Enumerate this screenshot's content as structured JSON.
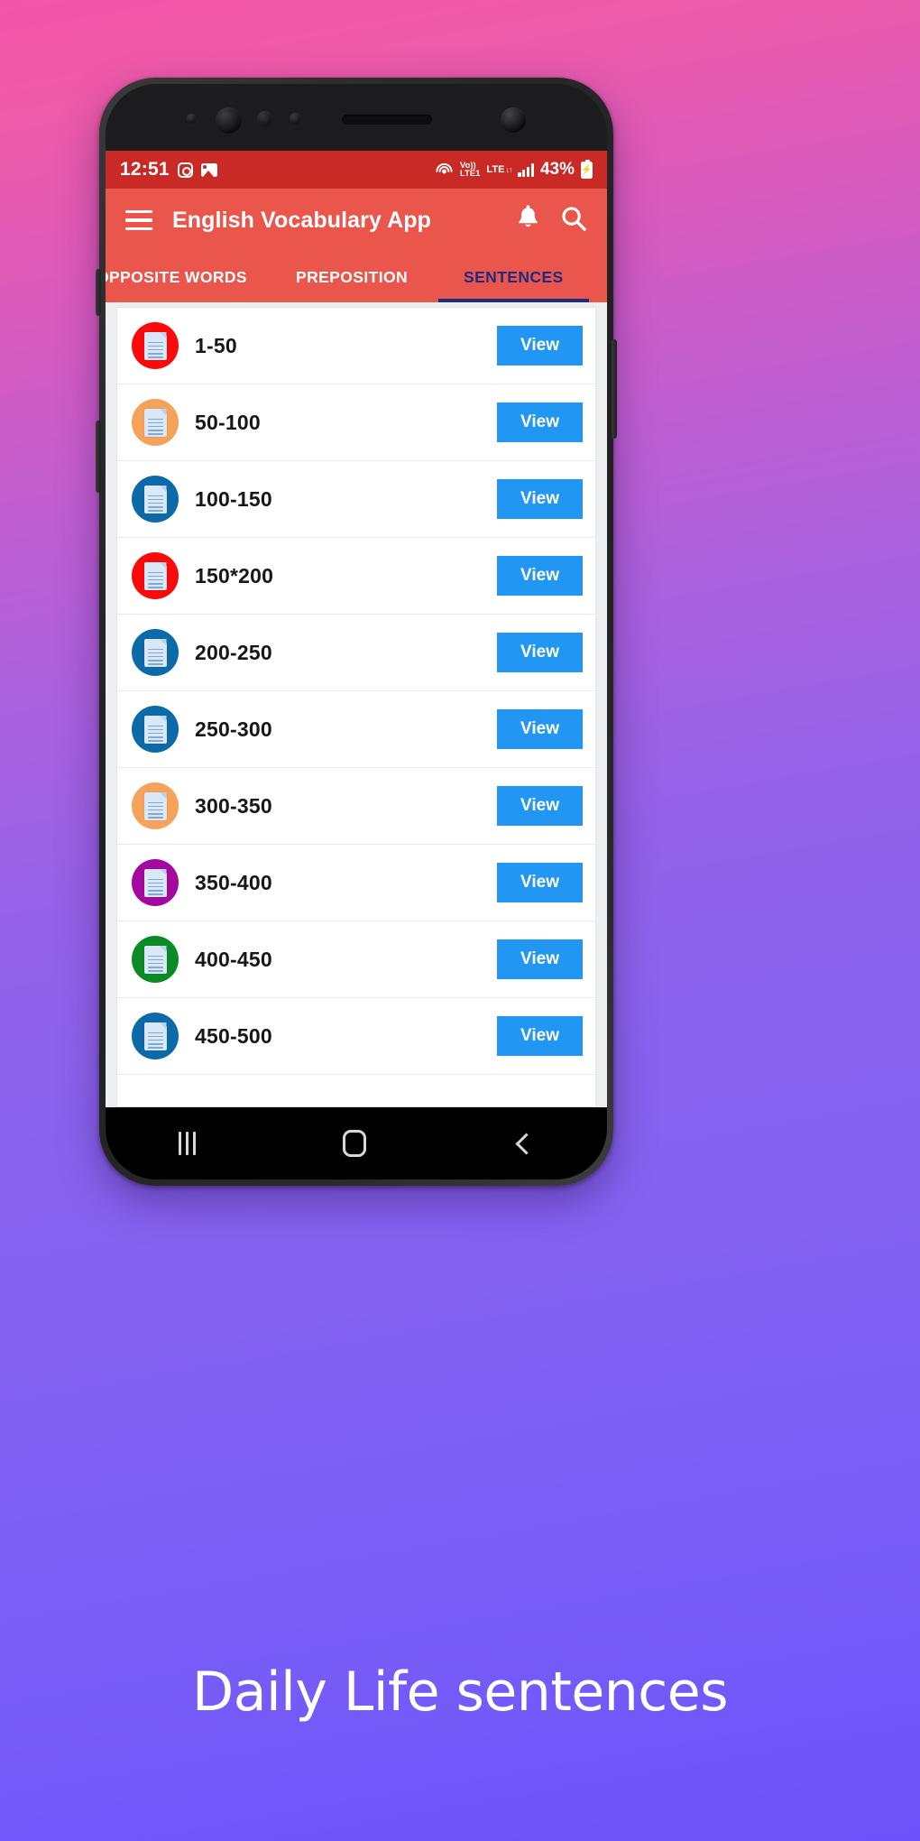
{
  "status_bar": {
    "time": "12:51",
    "icons_left": [
      "instagram-icon",
      "gallery-icon"
    ],
    "volte_line1": "Vo))",
    "volte_line2": "LTE1",
    "network": "LTE",
    "data_arrows": "↓↑",
    "battery_percent": "43%",
    "battery_icon": "battery-charging-icon",
    "bg_color": "#c92a26"
  },
  "appbar": {
    "menu_icon": "hamburger-menu-icon",
    "title": "English Vocabulary App",
    "notification_icon": "bell-icon",
    "search_icon": "search-icon",
    "bg_color": "#ea554c"
  },
  "tabs": {
    "active_color": "#1f2a82",
    "items": [
      {
        "label": "OPPOSITE WORDS",
        "active": false
      },
      {
        "label": "PREPOSITION",
        "active": false
      },
      {
        "label": "SENTENCES",
        "active": true
      }
    ]
  },
  "list": {
    "button_label": "View",
    "button_color": "#2196f3",
    "rows": [
      {
        "label": "1-50",
        "icon": "document-icon",
        "badge_color": "#fa0a0a"
      },
      {
        "label": "50-100",
        "icon": "document-icon",
        "badge_color": "#f5a25a"
      },
      {
        "label": "100-150",
        "icon": "document-icon",
        "badge_color": "#0d6aa8"
      },
      {
        "label": "150*200",
        "icon": "document-icon",
        "badge_color": "#fa0a0a"
      },
      {
        "label": "200-250",
        "icon": "document-icon",
        "badge_color": "#0d6aa8"
      },
      {
        "label": "250-300",
        "icon": "document-icon",
        "badge_color": "#0d6aa8"
      },
      {
        "label": "300-350",
        "icon": "document-icon",
        "badge_color": "#f5a25a"
      },
      {
        "label": "350-400",
        "icon": "document-icon",
        "badge_color": "#a4089e"
      },
      {
        "label": "400-450",
        "icon": "document-icon",
        "badge_color": "#0c8a26"
      },
      {
        "label": "450-500",
        "icon": "document-icon",
        "badge_color": "#0d6aa8"
      }
    ]
  },
  "navbar": {
    "recents": "recents-icon",
    "home": "home-icon",
    "back": "back-icon"
  },
  "caption": {
    "text": "Daily Life sentences"
  }
}
